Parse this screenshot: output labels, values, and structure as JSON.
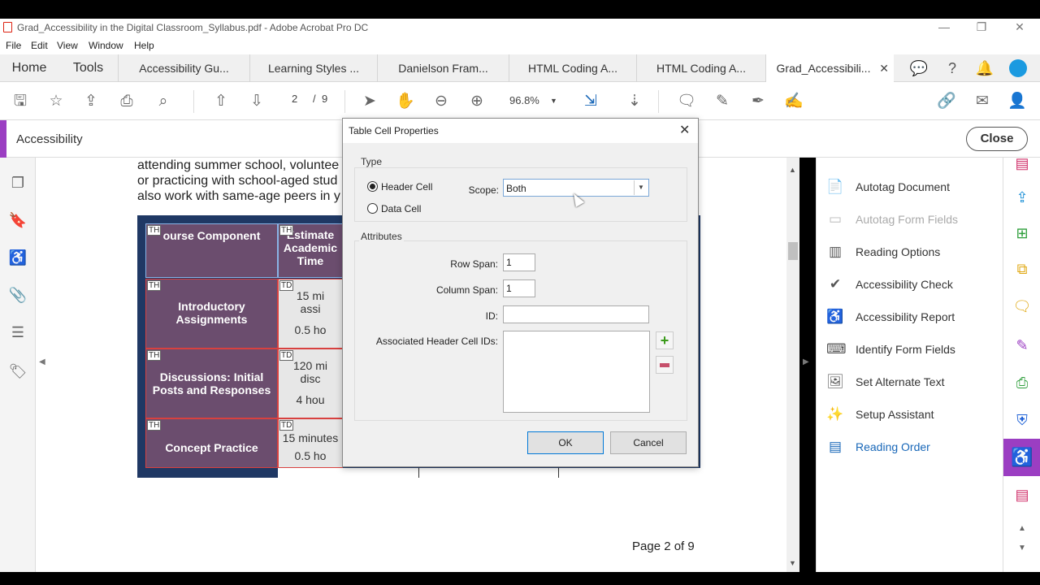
{
  "window": {
    "title": "Grad_Accessibility in the Digital Classroom_Syllabus.pdf - Adobe Acrobat Pro DC"
  },
  "menu": [
    "File",
    "Edit",
    "View",
    "Window",
    "Help"
  ],
  "tabs": {
    "home": "Home",
    "tools": "Tools",
    "docs": [
      "Accessibility Gu...",
      "Learning Styles ...",
      "Danielson Fram...",
      "HTML Coding A...",
      "HTML Coding A..."
    ],
    "active": "Grad_Accessibili..."
  },
  "toolbar": {
    "page_current": "2",
    "page_sep": "/",
    "page_total": "9",
    "zoom": "96.8%"
  },
  "accessibility_bar": {
    "label": "Accessibility",
    "close": "Close"
  },
  "document": {
    "lines": [
      "attending summer school, voluntee",
      "or practicing with school-aged stud",
      "also work with same-age peers in y"
    ],
    "table": {
      "header": [
        "ourse Component",
        "Estimate",
        "Academic",
        "Time"
      ],
      "rows": [
        {
          "tag": "TH",
          "label": "Introductory Assignments",
          "tdtag": "TD",
          "v1": "15 mi",
          "v2": "assi",
          "v3": "0.5 ho"
        },
        {
          "tag": "TH",
          "label": "Discussions: Initial Posts and Responses",
          "tdtag": "TD",
          "v1": "120 mi",
          "v2": "disc",
          "v3": "4 hou"
        },
        {
          "tag": "TH",
          "label": "Concept Practice",
          "tdtag": "TD",
          "v1": "15 minutes",
          "v2": "",
          "v3": "0.5 ho"
        }
      ],
      "th_tag": "TH"
    },
    "page_label": "Page 2 of 9"
  },
  "right_panel": {
    "items": [
      {
        "label": "Autotag Document",
        "icon": "autotag-icon",
        "state": "normal"
      },
      {
        "label": "Autotag Form Fields",
        "icon": "form-autotag-icon",
        "state": "disabled"
      },
      {
        "label": "Reading Options",
        "icon": "reading-options-icon",
        "state": "normal"
      },
      {
        "label": "Accessibility Check",
        "icon": "check-circle-icon",
        "state": "normal"
      },
      {
        "label": "Accessibility Report",
        "icon": "accessibility-person-icon",
        "state": "normal"
      },
      {
        "label": "Identify Form Fields",
        "icon": "form-fields-icon",
        "state": "normal"
      },
      {
        "label": "Set Alternate Text",
        "icon": "image-alt-icon",
        "state": "normal"
      },
      {
        "label": "Setup Assistant",
        "icon": "wand-icon",
        "state": "normal"
      },
      {
        "label": "Reading Order",
        "icon": "reading-order-icon",
        "state": "active"
      }
    ]
  },
  "dialog": {
    "title": "Table Cell Properties",
    "type_group": "Type",
    "header_cell": "Header Cell",
    "data_cell": "Data Cell",
    "scope_label": "Scope:",
    "scope_value": "Both",
    "attributes_group": "Attributes",
    "row_span_label": "Row Span:",
    "row_span_value": "1",
    "col_span_label": "Column Span:",
    "col_span_value": "1",
    "id_label": "ID:",
    "id_value": "",
    "assoc_label": "Associated Header Cell IDs:",
    "ok": "OK",
    "cancel": "Cancel"
  },
  "colors": {
    "accent": "#9b3ec2",
    "table_header": "#6b4d6e",
    "table_border": "#d8413f",
    "link_blue": "#1867b8"
  }
}
